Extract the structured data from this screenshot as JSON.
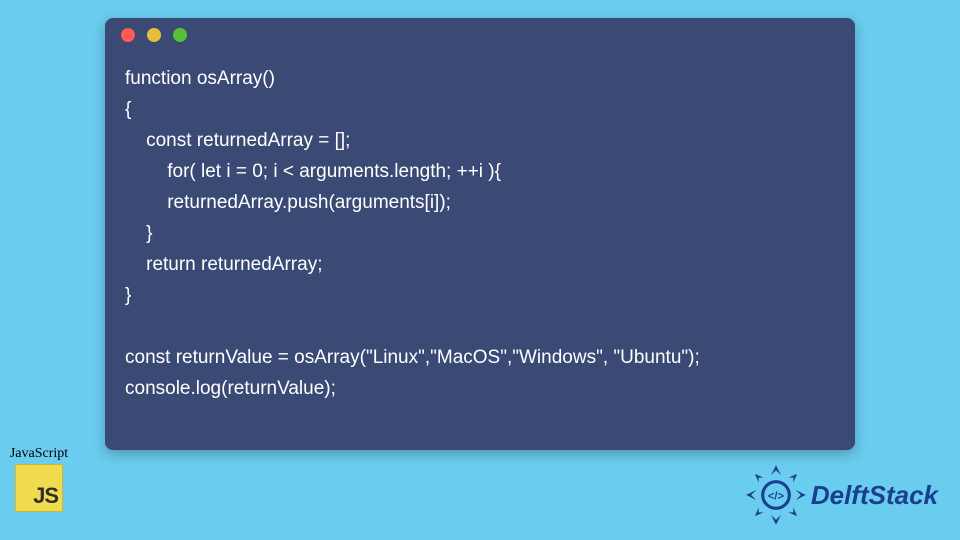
{
  "window": {
    "dots": [
      "red",
      "yellow",
      "green"
    ]
  },
  "code": {
    "lines": [
      "function osArray()",
      "{",
      "    const returnedArray = [];",
      "        for( let i = 0; i < arguments.length; ++i ){",
      "        returnedArray.push(arguments[i]);",
      "    }",
      "    return returnedArray;",
      "}",
      "",
      "const returnValue = osArray(\"Linux\",\"MacOS\",\"Windows\", \"Ubuntu\");",
      "console.log(returnValue);"
    ]
  },
  "js_badge": {
    "label": "JavaScript",
    "logo_text": "JS"
  },
  "brand": {
    "name": "DelftStack"
  },
  "colors": {
    "page_bg": "#6accee",
    "window_bg": "#3a4a75",
    "js_yellow": "#f0db4f",
    "brand_blue": "#1b3f8f"
  }
}
